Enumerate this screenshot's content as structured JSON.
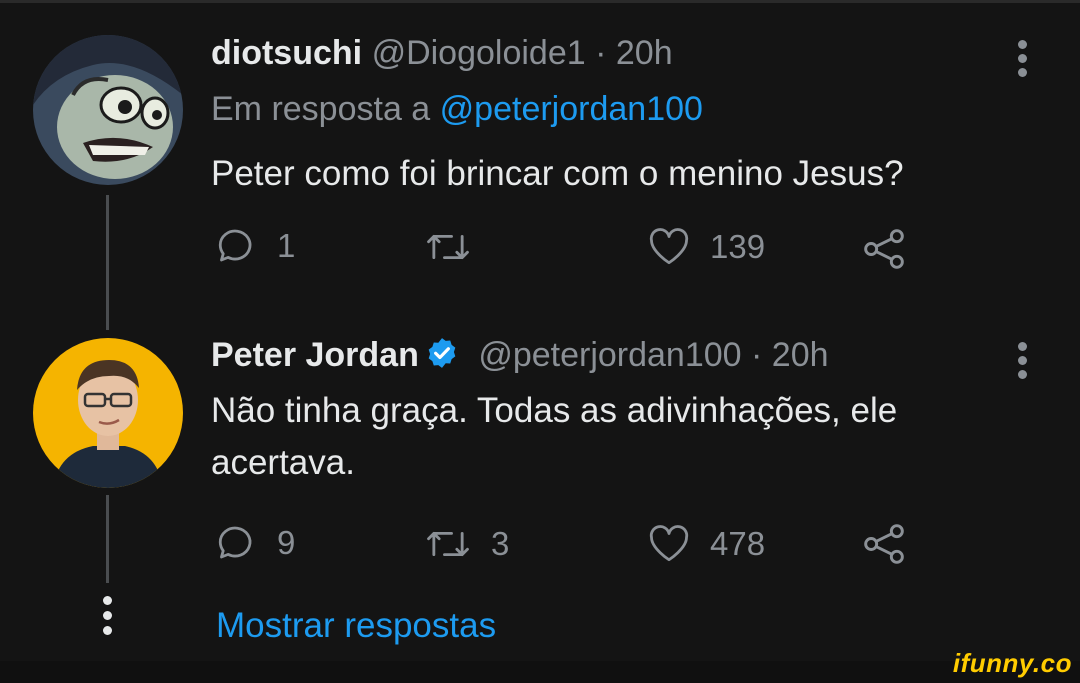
{
  "tweets": [
    {
      "name": "diotsuchi",
      "handle": "@Diogoloide1",
      "time": "· 20h",
      "reply_prefix": "Em resposta a",
      "reply_to": "@peterjordan100",
      "text": "Peter como foi brincar com o menino Jesus?",
      "actions": {
        "reply": "1",
        "retweet": "",
        "like": "139"
      }
    },
    {
      "name": "Peter Jordan",
      "handle": "@peterjordan100",
      "time": "· 20h",
      "verified": true,
      "text_line1": "Não tinha graça. Todas as adivinhações, ele",
      "text_line2": "acertava.",
      "actions": {
        "reply": "9",
        "retweet": "3",
        "like": "478"
      }
    }
  ],
  "show_replies": "Mostrar respostas",
  "watermark": "ifunny.co",
  "colors": {
    "background": "#141414",
    "link": "#1d9bf0",
    "muted": "#8b9096",
    "text": "#e7e9ea",
    "verified": "#1d9bf0"
  }
}
